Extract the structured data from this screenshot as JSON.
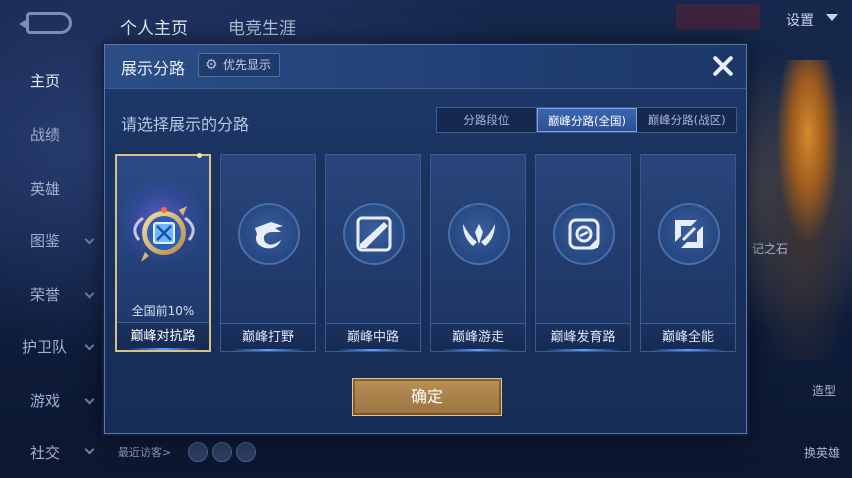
{
  "background": {
    "tabs": [
      "个人主页",
      "电竞生涯"
    ],
    "settings_label": "设置",
    "left_nav": [
      "主页",
      "战绩",
      "英雄",
      "图鉴",
      "荣誉",
      "护卫队",
      "游戏",
      "社交"
    ],
    "recent_visitors": "最近访客>",
    "right_labels": [
      "记之石",
      "造型",
      "换英雄"
    ]
  },
  "modal": {
    "title": "展示分路",
    "priority_button": "优先显示",
    "prompt": "请选择展示的分路",
    "segment_tabs": [
      {
        "label": "分路段位",
        "active": false
      },
      {
        "label": "巅峰分路(全国)",
        "active": true
      },
      {
        "label": "巅峰分路(战区)",
        "active": false
      }
    ],
    "cards": [
      {
        "label": "巅峰对抗路",
        "rank": "全国前10%",
        "selected": true,
        "icon": "medal-icon"
      },
      {
        "label": "巅峰打野",
        "selected": false,
        "icon": "dragon-icon"
      },
      {
        "label": "巅峰中路",
        "selected": false,
        "icon": "slash-icon"
      },
      {
        "label": "巅峰游走",
        "selected": false,
        "icon": "wings-icon"
      },
      {
        "label": "巅峰发育路",
        "selected": false,
        "icon": "target-icon"
      },
      {
        "label": "巅峰全能",
        "selected": false,
        "icon": "swirl-icon"
      }
    ],
    "confirm_button": "确定"
  },
  "colors": {
    "accent_gold": "#b88f56",
    "active_tab": "#3d66b0",
    "panel": "#1f3b6d"
  }
}
